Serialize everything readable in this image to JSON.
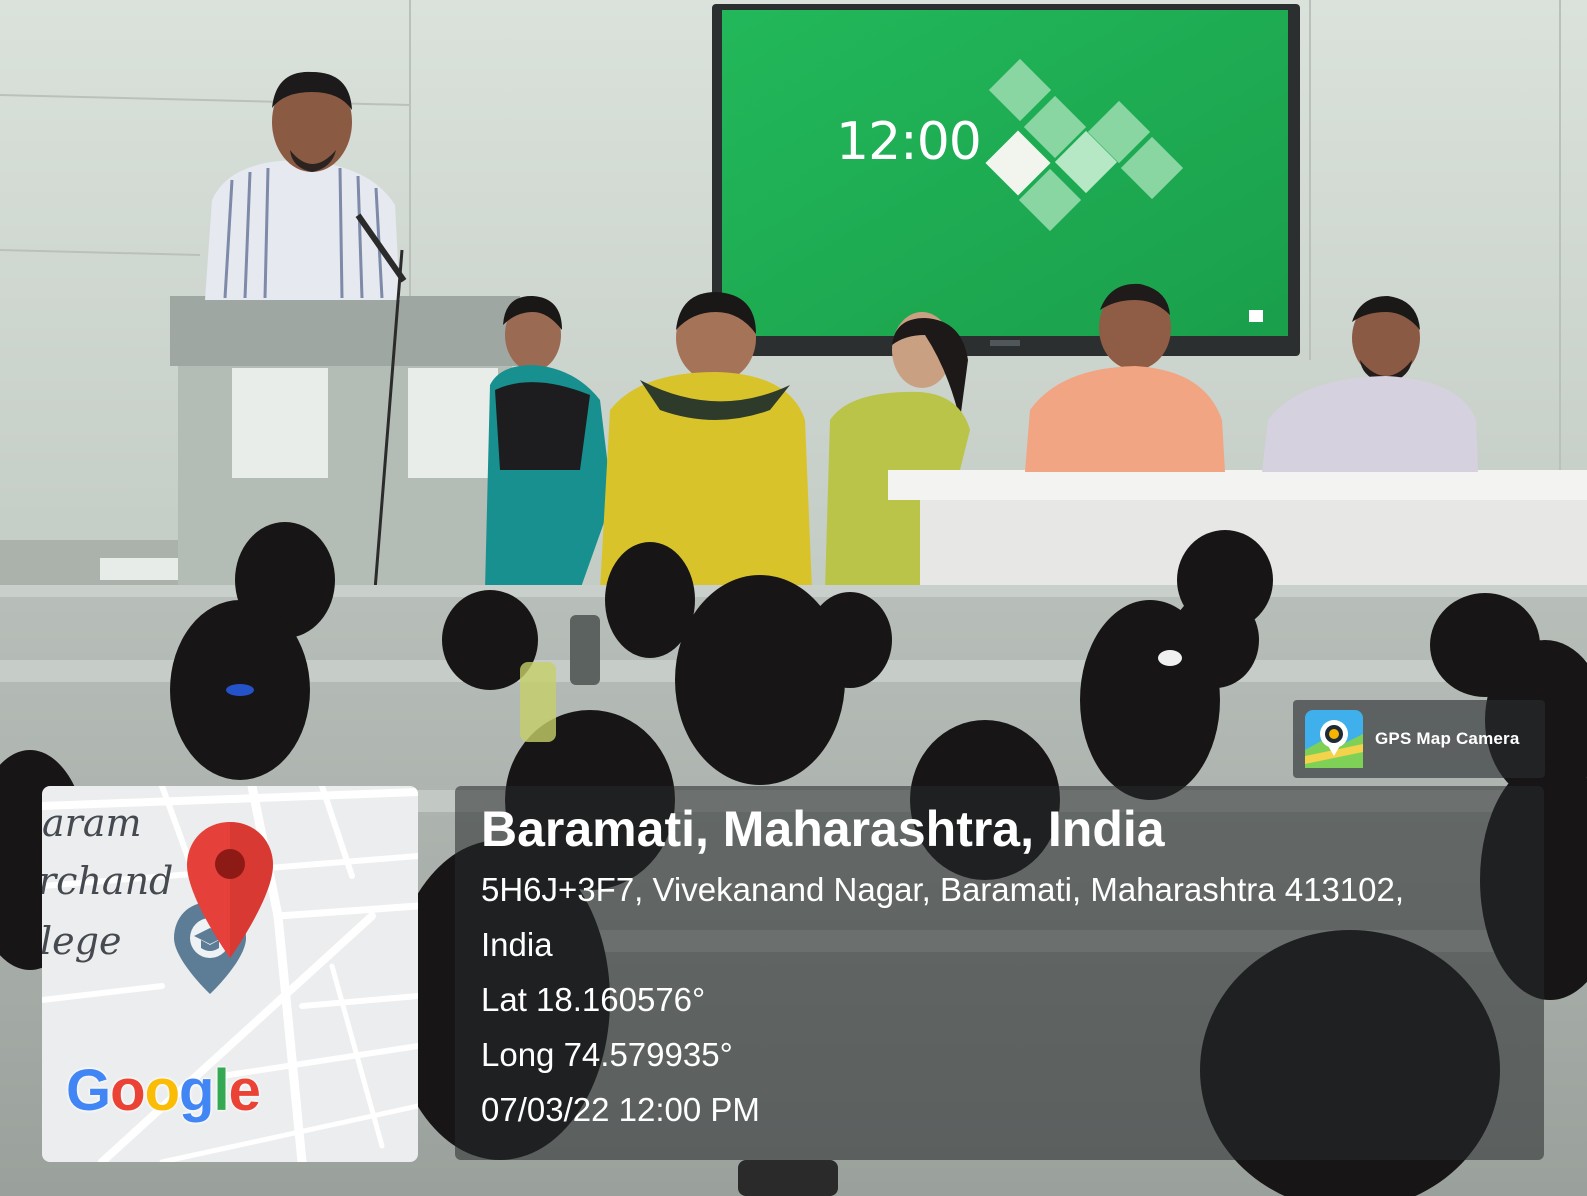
{
  "watermark": {
    "app_icon": "gps-map-camera-icon",
    "app_name": "GPS Map Camera"
  },
  "map": {
    "labels": [
      "aram",
      "rchand",
      "lege"
    ],
    "pin_icon": "location-pin-icon",
    "poi_icon": "school-poi-icon",
    "logo": {
      "letters": [
        "G",
        "o",
        "o",
        "g",
        "l",
        "e"
      ],
      "colors": [
        "#4285F4",
        "#EA4335",
        "#FBBC05",
        "#4285F4",
        "#34A853",
        "#EA4335"
      ]
    }
  },
  "location": {
    "title": "Baramati, Maharashtra, India",
    "address_line1": "5H6J+3F7, Vivekanand Nagar, Baramati, Maharashtra 413102,",
    "address_line2": "India",
    "lat": "Lat 18.160576°",
    "long": "Long 74.579935°",
    "datetime": "07/03/22 12:00 PM"
  },
  "screen": {
    "clock": "12:00"
  },
  "colors": {
    "screen_green": "#1fb055",
    "wall": "#cfd6d0",
    "pin_red": "#e5413a"
  }
}
